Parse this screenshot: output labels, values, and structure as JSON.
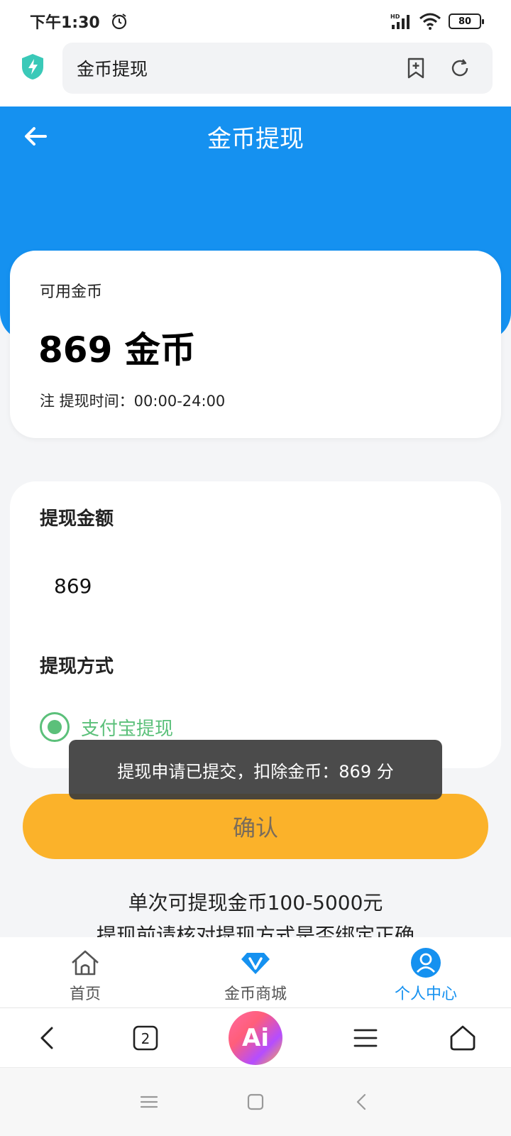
{
  "status_bar": {
    "time": "下午1:30",
    "battery": "80"
  },
  "browser": {
    "url_title": "金币提现"
  },
  "header": {
    "title": "金币提现"
  },
  "coin_card": {
    "label": "可用金币",
    "amount": "869 金币",
    "note": "注 提现时间：00:00-24:00"
  },
  "withdraw": {
    "amount_label": "提现金额",
    "amount_value": "869",
    "method_label": "提现方式",
    "method_option": "支付宝提现"
  },
  "toast": {
    "message": "提现申请已提交，扣除金币：869 分"
  },
  "confirm_label": "确认",
  "info": {
    "line1": "单次可提现金币100-5000元",
    "line2": "提现前请核对提现方式是否绑定正确"
  },
  "web_nav": {
    "items": [
      {
        "label": "首页",
        "icon": "home-icon"
      },
      {
        "label": "金币商城",
        "icon": "diamond-icon"
      },
      {
        "label": "个人中心",
        "icon": "user-icon"
      }
    ]
  },
  "toolbar": {
    "tab_count": "2",
    "ai_label": "Ai"
  },
  "colors": {
    "primary_blue": "#1591f0",
    "confirm_yellow": "#fbb22a",
    "radio_green": "#5bc07a"
  }
}
